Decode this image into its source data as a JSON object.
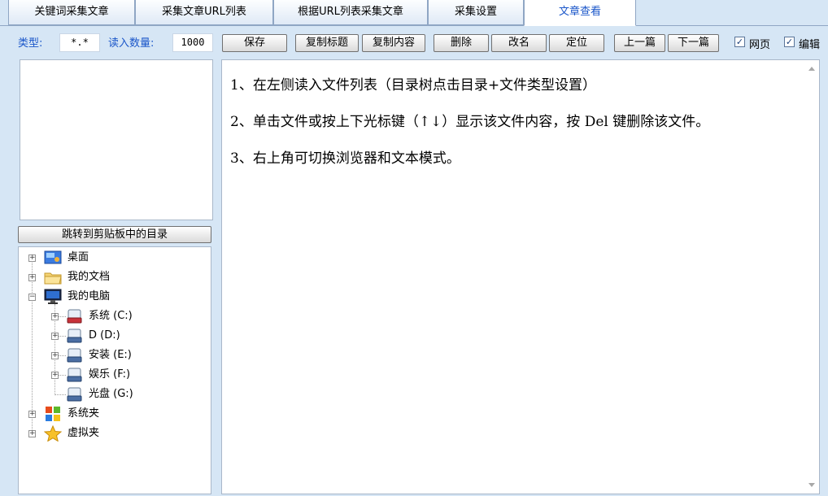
{
  "tabs": [
    {
      "label": "关键词采集文章"
    },
    {
      "label": "采集文章URL列表"
    },
    {
      "label": "根据URL列表采集文章"
    },
    {
      "label": "采集设置"
    },
    {
      "label": "文章查看"
    }
  ],
  "toolbar": {
    "type_label": "类型:",
    "type_value": "*.*",
    "count_label": "读入数量:",
    "count_value": "1000",
    "save": "保存",
    "copy_title": "复制标题",
    "copy_content": "复制内容",
    "delete": "删除",
    "rename": "改名",
    "locate": "定位",
    "prev": "上一篇",
    "next": "下一篇",
    "webpage": {
      "label": "网页",
      "checked": true
    },
    "edit": {
      "label": "编辑",
      "checked": true
    }
  },
  "left": {
    "jump_button": "跳转到剪贴板中的目录",
    "tree": [
      {
        "label": "桌面",
        "icon": "desktop-icon"
      },
      {
        "label": "我的文档",
        "icon": "folder-icon"
      },
      {
        "label": "我的电脑",
        "icon": "computer-icon"
      },
      {
        "label": "系统 (C:)",
        "icon": "system-drive-icon"
      },
      {
        "label": "D (D:)",
        "icon": "drive-icon"
      },
      {
        "label": "安装 (E:)",
        "icon": "drive-icon"
      },
      {
        "label": "娱乐 (F:)",
        "icon": "drive-icon"
      },
      {
        "label": "光盘 (G:)",
        "icon": "drive-icon"
      },
      {
        "label": "系统夹",
        "icon": "windows-icon"
      },
      {
        "label": "虚拟夹",
        "icon": "star-icon"
      }
    ]
  },
  "content": {
    "lines": [
      "1、在左侧读入文件列表（目录树点击目录+文件类型设置）",
      "2、单击文件或按上下光标键（↑↓）显示该文件内容，按 Del 键删除该文件。",
      "3、右上角可切换浏览器和文本模式。"
    ]
  },
  "colors": {
    "accent": "#1a56c9",
    "background": "#d6e6f5"
  }
}
